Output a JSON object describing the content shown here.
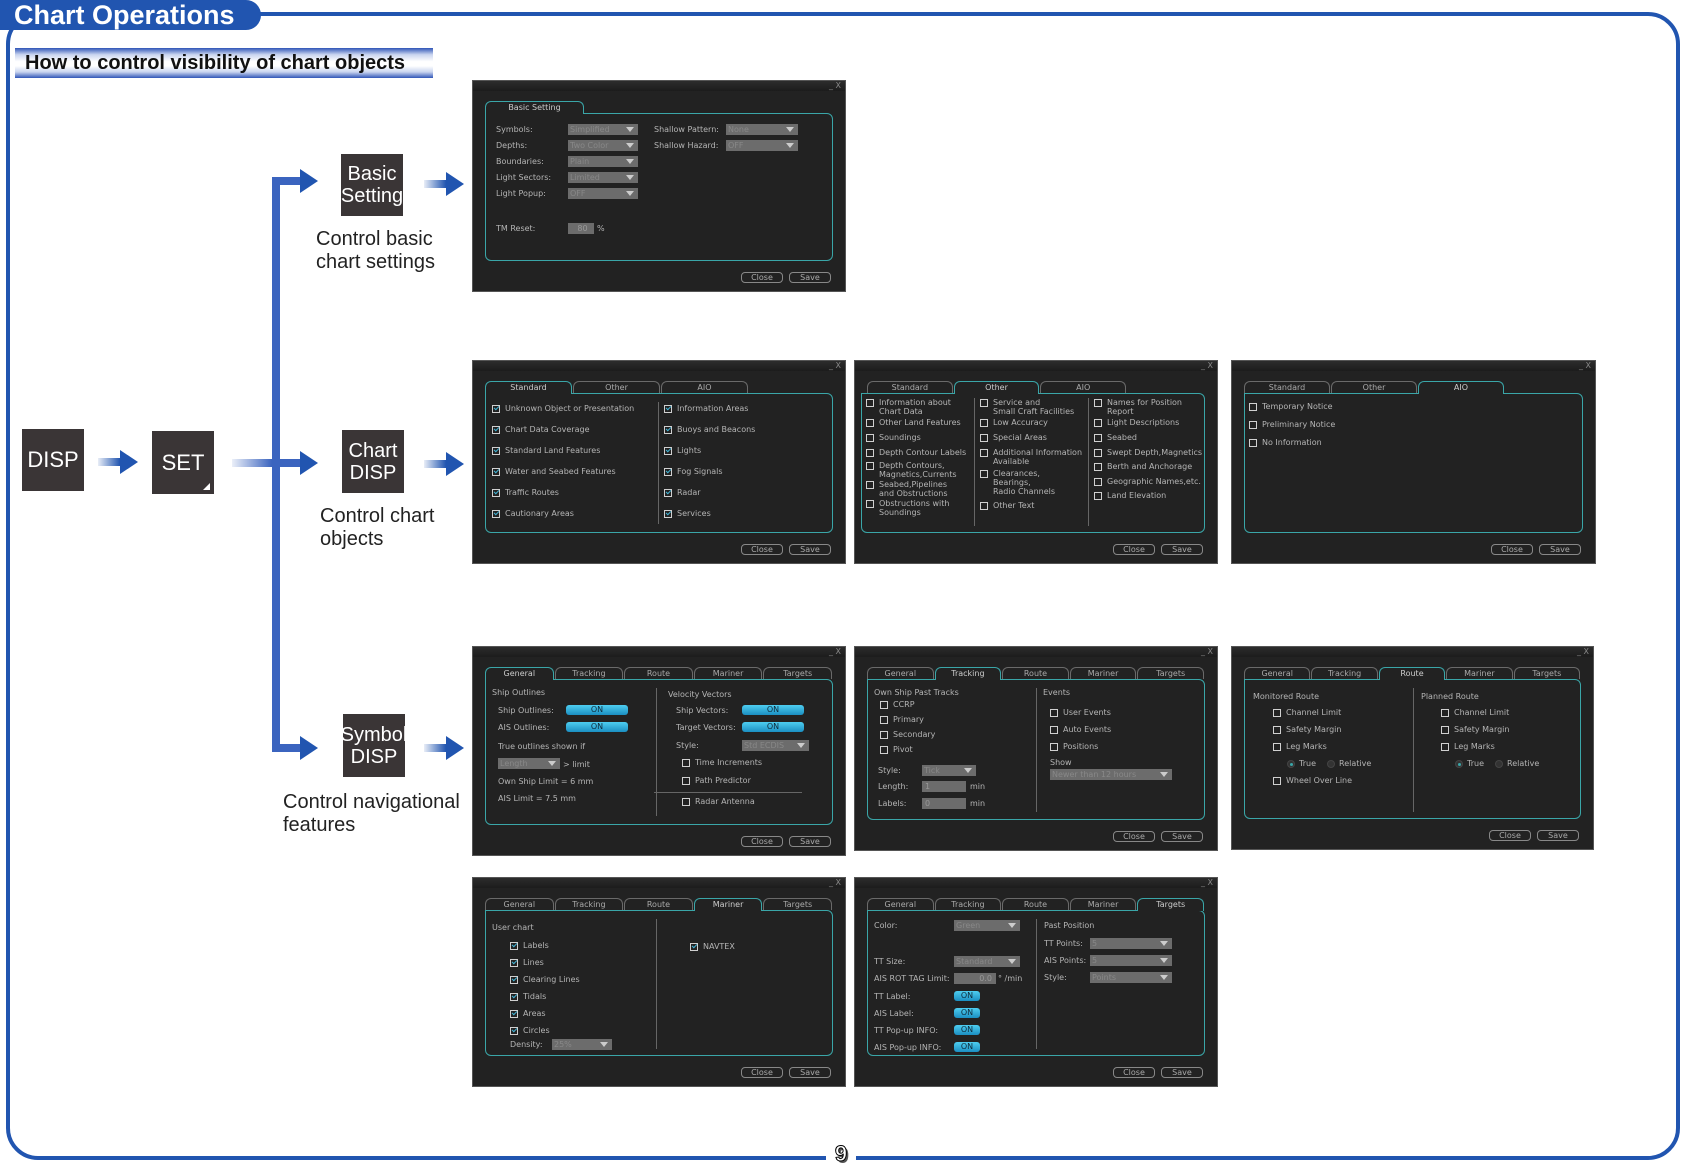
{
  "page": {
    "title": "Chart Operations",
    "section_heading": "How to control visibility of chart objects",
    "page_number": "9",
    "accent_color": "#2155b0"
  },
  "flow": {
    "keys": {
      "disp": "DISP",
      "set": "SET",
      "basic_setting": [
        "Basic",
        "Setting"
      ],
      "chart_disp": [
        "Chart",
        "DISP"
      ],
      "symbol_disp": [
        "Symbol",
        "DISP"
      ]
    },
    "captions": {
      "basic_setting": [
        "Control basic",
        "chart settings"
      ],
      "chart_disp": [
        "Control chart",
        "objects"
      ],
      "symbol_disp": [
        "Control navigational",
        "features"
      ]
    }
  },
  "common": {
    "close": "Close",
    "save": "Save",
    "win_controls": "_ X"
  },
  "basic_setting_dialog": {
    "tab": "Basic Setting",
    "fields": [
      {
        "label": "Symbols:",
        "value": "Simplified"
      },
      {
        "label": "Depths:",
        "value": "Two Color"
      },
      {
        "label": "Boundaries:",
        "value": "Plain"
      },
      {
        "label": "Light Sectors:",
        "value": "Limited"
      },
      {
        "label": "Light Popup:",
        "value": "OFF"
      }
    ],
    "right_fields": [
      {
        "label": "Shallow Pattern:",
        "value": "None"
      },
      {
        "label": "Shallow Hazard:",
        "value": "OFF"
      }
    ],
    "tm_reset": {
      "label": "TM Reset:",
      "value": "80",
      "unit": "%"
    }
  },
  "chart_disp_tabs": [
    "Standard",
    "Other",
    "AIO"
  ],
  "chart_disp_standard": {
    "left": [
      {
        "label": "Unknown Object or Presentation",
        "checked": true
      },
      {
        "label": "Chart Data Coverage",
        "checked": true
      },
      {
        "label": "Standard Land Features",
        "checked": true
      },
      {
        "label": "Water and Seabed Features",
        "checked": true
      },
      {
        "label": "Traffic Routes",
        "checked": true
      },
      {
        "label": "Cautionary Areas",
        "checked": true
      }
    ],
    "right": [
      {
        "label": "Information Areas",
        "checked": true
      },
      {
        "label": "Buoys and Beacons",
        "checked": true
      },
      {
        "label": "Lights",
        "checked": true
      },
      {
        "label": "Fog Signals",
        "checked": true
      },
      {
        "label": "Radar",
        "checked": true
      },
      {
        "label": "Services",
        "checked": true
      }
    ]
  },
  "chart_disp_other": {
    "col1": [
      {
        "label": "Information about\nChart Data",
        "checked": false
      },
      {
        "label": "Other Land Features",
        "checked": false
      },
      {
        "label": "Soundings",
        "checked": false
      },
      {
        "label": "Depth Contour Labels",
        "checked": false
      },
      {
        "label": "Depth Contours,\nMagnetics,Currents",
        "checked": false
      },
      {
        "label": "Seabed,Pipelines\nand Obstructions",
        "checked": false
      },
      {
        "label": "Obstructions with\nSoundings",
        "checked": false
      }
    ],
    "col2": [
      {
        "label": "Service and\nSmall Craft Facilities",
        "checked": false
      },
      {
        "label": "Low Accuracy",
        "checked": false
      },
      {
        "label": "Special Areas",
        "checked": false
      },
      {
        "label": "Additional Information\nAvailable",
        "checked": false
      },
      {
        "label": "Clearances,\nBearings,\nRadio Channels",
        "checked": false
      },
      {
        "label": "Other Text",
        "checked": false
      }
    ],
    "col3": [
      {
        "label": "Names for Position\nReport",
        "checked": false
      },
      {
        "label": "Light Descriptions",
        "checked": false
      },
      {
        "label": "Seabed",
        "checked": false
      },
      {
        "label": "Swept Depth,Magnetics",
        "checked": false
      },
      {
        "label": "Berth and Anchorage",
        "checked": false
      },
      {
        "label": "Geographic Names,etc.",
        "checked": false
      },
      {
        "label": "Land Elevation",
        "checked": false
      }
    ]
  },
  "chart_disp_aio": [
    {
      "label": "Temporary Notice",
      "checked": false
    },
    {
      "label": "Preliminary Notice",
      "checked": false
    },
    {
      "label": "No Information",
      "checked": false
    }
  ],
  "symbol_disp_tabs": [
    "General",
    "Tracking",
    "Route",
    "Mariner",
    "Targets"
  ],
  "symbol_general": {
    "ship_outlines_heading": "Ship Outlines",
    "ship_outlines": {
      "label": "Ship Outlines:",
      "value": "ON"
    },
    "ais_outlines": {
      "label": "AIS Outlines:",
      "value": "ON"
    },
    "true_outlines_label": "True outlines shown if",
    "true_outlines_select": "Length",
    "limit_suffix": "> limit",
    "own_ship_limit": "Own Ship Limit =  6 mm",
    "ais_limit": "AIS Limit =  7.5 mm",
    "velocity_heading": "Velocity Vectors",
    "ship_vectors": {
      "label": "Ship Vectors:",
      "value": "ON"
    },
    "target_vectors": {
      "label": "Target Vectors:",
      "value": "ON"
    },
    "style_label": "Style:",
    "style_value": "Std ECDIS",
    "checks": [
      {
        "label": "Time Increments",
        "checked": false
      },
      {
        "label": "Path Predictor",
        "checked": false
      },
      {
        "label": "Radar Antenna",
        "checked": false
      }
    ]
  },
  "symbol_tracking": {
    "heading": "Own Ship Past Tracks",
    "tracks": [
      {
        "label": "CCRP",
        "checked": false
      },
      {
        "label": "Primary",
        "checked": false
      },
      {
        "label": "Secondary",
        "checked": false
      },
      {
        "label": "Pivot",
        "checked": false
      }
    ],
    "style": {
      "label": "Style:",
      "value": "Tick"
    },
    "length": {
      "label": "Length:",
      "value": "1",
      "unit": "min"
    },
    "labels": {
      "label": "Labels:",
      "value": "0",
      "unit": "min"
    },
    "events_heading": "Events",
    "events": [
      {
        "label": "User Events",
        "checked": false
      },
      {
        "label": "Auto Events",
        "checked": false
      },
      {
        "label": "Positions",
        "checked": false
      }
    ],
    "show_label": "Show",
    "show_value": "Newer than 12 hours"
  },
  "symbol_route": {
    "monitored": {
      "heading": "Monitored Route",
      "items": [
        {
          "label": "Channel Limit",
          "checked": false
        },
        {
          "label": "Safety Margin",
          "checked": false
        },
        {
          "label": "Leg Marks",
          "checked": false
        }
      ],
      "radio": [
        {
          "label": "True",
          "selected": true
        },
        {
          "label": "Relative",
          "selected": false
        }
      ],
      "extra": {
        "label": "Wheel Over Line",
        "checked": false
      }
    },
    "planned": {
      "heading": "Planned Route",
      "items": [
        {
          "label": "Channel Limit",
          "checked": false
        },
        {
          "label": "Safety Margin",
          "checked": false
        },
        {
          "label": "Leg Marks",
          "checked": false
        }
      ],
      "radio": [
        {
          "label": "True",
          "selected": true
        },
        {
          "label": "Relative",
          "selected": false
        }
      ]
    }
  },
  "symbol_mariner": {
    "heading": "User chart",
    "items": [
      {
        "label": "Labels",
        "checked": true
      },
      {
        "label": "Lines",
        "checked": true
      },
      {
        "label": "Clearing Lines",
        "checked": true
      },
      {
        "label": "Tidals",
        "checked": true
      },
      {
        "label": "Areas",
        "checked": true
      },
      {
        "label": "Circles",
        "checked": true
      }
    ],
    "density": {
      "label": "Density:",
      "value": "25%"
    },
    "navtex": {
      "label": "NAVTEX",
      "checked": true
    }
  },
  "symbol_targets": {
    "color": {
      "label": "Color:",
      "value": "Green"
    },
    "tt_size": {
      "label": "TT Size:",
      "value": "Standard"
    },
    "ais_rot": {
      "label": "AIS ROT TAG Limit:",
      "value": "0.0",
      "unit": "° /min"
    },
    "toggles": [
      {
        "label": "TT Label:",
        "value": "ON"
      },
      {
        "label": "AIS Label:",
        "value": "ON"
      },
      {
        "label": "TT Pop-up INFO:",
        "value": "ON"
      },
      {
        "label": "AIS Pop-up INFO:",
        "value": "ON"
      }
    ],
    "past_position_heading": "Past Position",
    "tt_points": {
      "label": "TT Points:",
      "value": "5"
    },
    "ais_points": {
      "label": "AIS Points:",
      "value": "5"
    },
    "style": {
      "label": "Style:",
      "value": "Points"
    }
  }
}
